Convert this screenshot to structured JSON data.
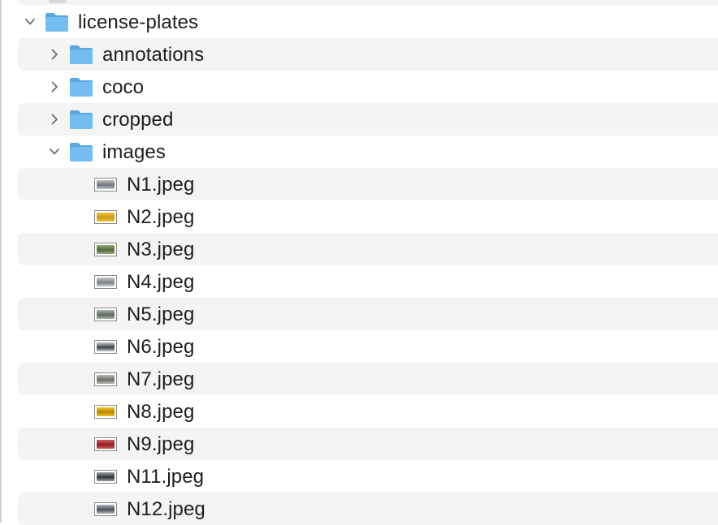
{
  "tree": {
    "root": {
      "name": "license-plates",
      "expanded": true,
      "icon": "folder-icon"
    },
    "folders": [
      {
        "name": "annotations",
        "expanded": false
      },
      {
        "name": "coco",
        "expanded": false
      },
      {
        "name": "cropped",
        "expanded": false
      },
      {
        "name": "images",
        "expanded": true
      }
    ],
    "files": [
      {
        "name": "N1.jpeg",
        "thumb_color": "#6f747a",
        "thumb_accent": "#bfc3c7"
      },
      {
        "name": "N2.jpeg",
        "thumb_color": "#c99a1a",
        "thumb_accent": "#f2c232"
      },
      {
        "name": "N3.jpeg",
        "thumb_color": "#4f6a3c",
        "thumb_accent": "#9aa67a"
      },
      {
        "name": "N4.jpeg",
        "thumb_color": "#7c8086",
        "thumb_accent": "#c8ccd0"
      },
      {
        "name": "N5.jpeg",
        "thumb_color": "#5b6a62",
        "thumb_accent": "#a9b4ac"
      },
      {
        "name": "N6.jpeg",
        "thumb_color": "#3f4348",
        "thumb_accent": "#c4c7ca"
      },
      {
        "name": "N7.jpeg",
        "thumb_color": "#6a6e66",
        "thumb_accent": "#b7bbb1"
      },
      {
        "name": "N8.jpeg",
        "thumb_color": "#b8860b",
        "thumb_accent": "#f0c419"
      },
      {
        "name": "N9.jpeg",
        "thumb_color": "#8c1e22",
        "thumb_accent": "#d05a5f"
      },
      {
        "name": "N11.jpeg",
        "thumb_color": "#2f3236",
        "thumb_accent": "#9ea2a6"
      },
      {
        "name": "N12.jpeg",
        "thumb_color": "#4a5058",
        "thumb_accent": "#b0b6bd"
      }
    ]
  },
  "colors": {
    "folder_body": "#74bdf0",
    "folder_tab": "#5aa8e2",
    "stripe": "#f4f4f5",
    "chevron": "#6e6e73"
  }
}
